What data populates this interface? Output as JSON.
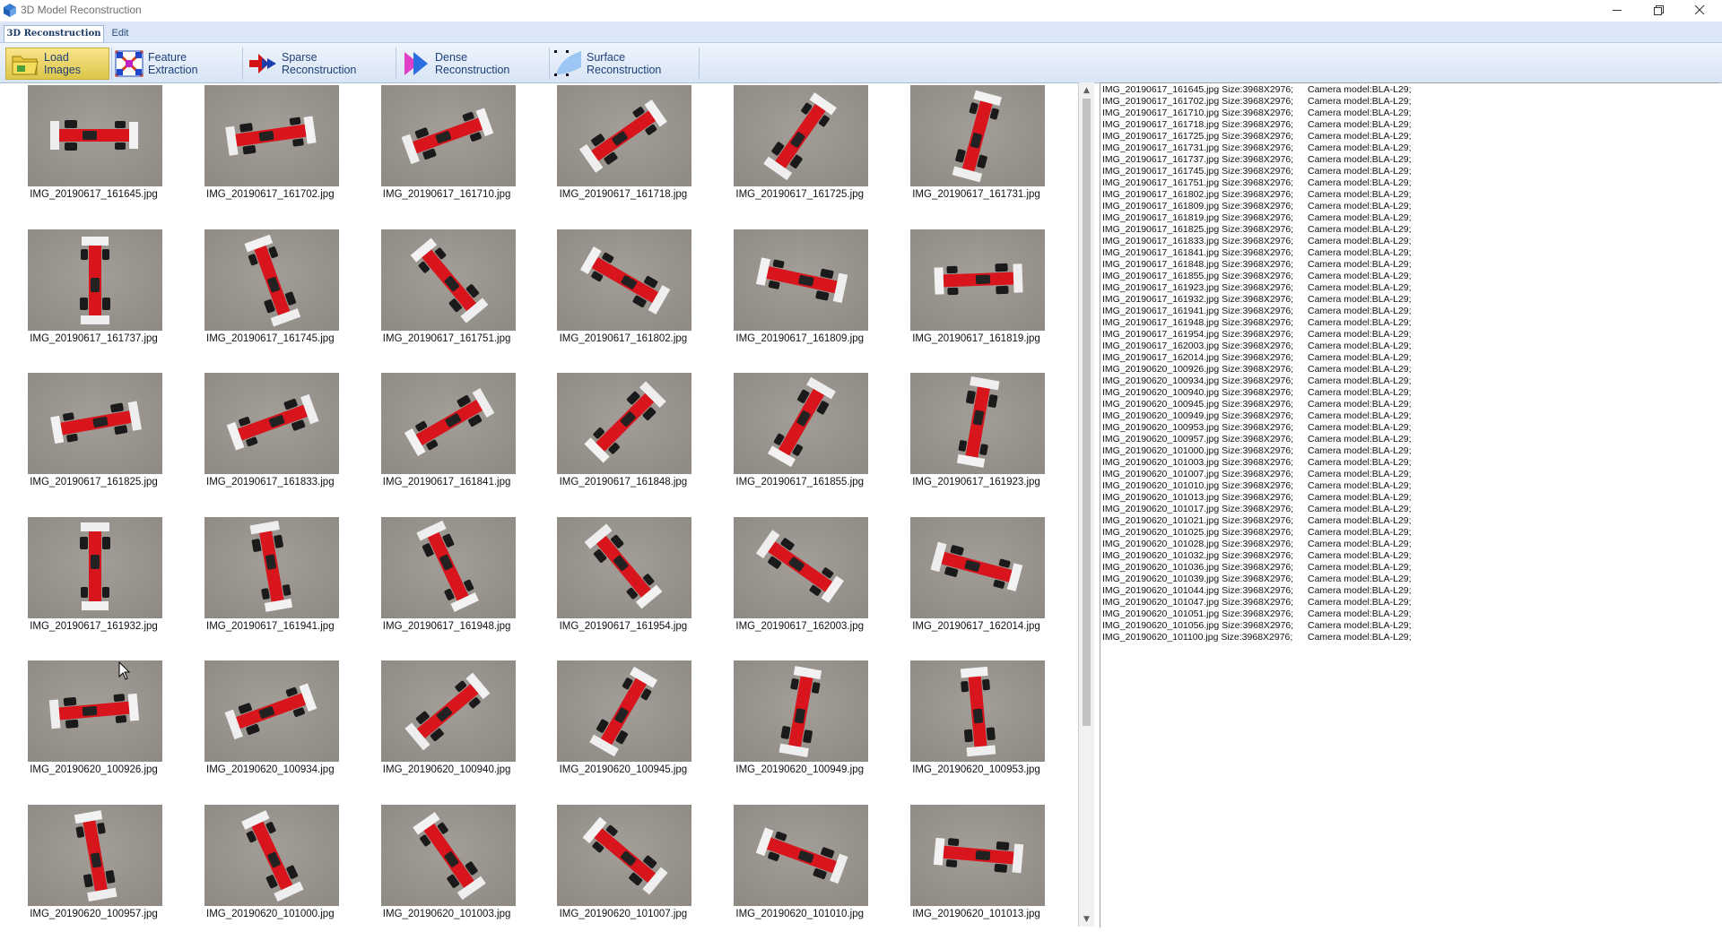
{
  "window": {
    "title": "3D Model Reconstruction",
    "controls": [
      "minimize-icon",
      "restore-icon",
      "close-icon"
    ]
  },
  "menu": {
    "tabs": [
      {
        "label": "3D Reconstruction",
        "active": true
      },
      {
        "label": "Edit",
        "active": false
      }
    ]
  },
  "toolbar": {
    "steps": [
      {
        "label": "Load Images",
        "icon": "folder-icon",
        "active": true
      },
      {
        "label": "Feature Extraction",
        "icon": "feature-grid-icon",
        "active": false
      },
      {
        "label": "Sparse Reconstruction",
        "icon": "sparse-arrows-icon",
        "active": false
      },
      {
        "label": "Dense Reconstruction",
        "icon": "dense-arrows-icon",
        "active": false
      },
      {
        "label": "Surface Reconstruction",
        "icon": "surface-icon",
        "active": false
      }
    ]
  },
  "gallery": {
    "images": [
      "IMG_20190617_161645.jpg",
      "IMG_20190617_161702.jpg",
      "IMG_20190617_161710.jpg",
      "IMG_20190617_161718.jpg",
      "IMG_20190617_161725.jpg",
      "IMG_20190617_161731.jpg",
      "IMG_20190617_161737.jpg",
      "IMG_20190617_161745.jpg",
      "IMG_20190617_161751.jpg",
      "IMG_20190617_161802.jpg",
      "IMG_20190617_161809.jpg",
      "IMG_20190617_161819.jpg",
      "IMG_20190617_161825.jpg",
      "IMG_20190617_161833.jpg",
      "IMG_20190617_161841.jpg",
      "IMG_20190617_161848.jpg",
      "IMG_20190617_161855.jpg",
      "IMG_20190617_161923.jpg",
      "IMG_20190617_161932.jpg",
      "IMG_20190617_161941.jpg",
      "IMG_20190617_161948.jpg",
      "IMG_20190617_161954.jpg",
      "IMG_20190617_162003.jpg",
      "IMG_20190617_162014.jpg",
      "IMG_20190620_100926.jpg",
      "IMG_20190620_100934.jpg",
      "IMG_20190620_100940.jpg",
      "IMG_20190620_100945.jpg",
      "IMG_20190620_100949.jpg",
      "IMG_20190620_100953.jpg",
      "IMG_20190620_100957.jpg",
      "IMG_20190620_101000.jpg",
      "IMG_20190620_101003.jpg",
      "IMG_20190620_101007.jpg",
      "IMG_20190620_101010.jpg",
      "IMG_20190620_101013.jpg"
    ],
    "thumbnail_subject": "red formula race car model on grey carpet"
  },
  "log": {
    "lines": [
      {
        "file": "IMG_20190617_161645.jpg Size:3968X2976;",
        "camera": "Camera model:BLA-L29;"
      },
      {
        "file": "IMG_20190617_161702.jpg Size:3968X2976;",
        "camera": "Camera model:BLA-L29;"
      },
      {
        "file": "IMG_20190617_161710.jpg Size:3968X2976;",
        "camera": "Camera model:BLA-L29;"
      },
      {
        "file": "IMG_20190617_161718.jpg Size:3968X2976;",
        "camera": "Camera model:BLA-L29;"
      },
      {
        "file": "IMG_20190617_161725.jpg Size:3968X2976;",
        "camera": "Camera model:BLA-L29;"
      },
      {
        "file": "IMG_20190617_161731.jpg Size:3968X2976;",
        "camera": "Camera model:BLA-L29;"
      },
      {
        "file": "IMG_20190617_161737.jpg Size:3968X2976;",
        "camera": "Camera model:BLA-L29;"
      },
      {
        "file": "IMG_20190617_161745.jpg Size:3968X2976;",
        "camera": "Camera model:BLA-L29;"
      },
      {
        "file": "IMG_20190617_161751.jpg Size:3968X2976;",
        "camera": "Camera model:BLA-L29;"
      },
      {
        "file": "IMG_20190617_161802.jpg Size:3968X2976;",
        "camera": "Camera model:BLA-L29;"
      },
      {
        "file": "IMG_20190617_161809.jpg Size:3968X2976;",
        "camera": "Camera model:BLA-L29;"
      },
      {
        "file": "IMG_20190617_161819.jpg Size:3968X2976;",
        "camera": "Camera model:BLA-L29;"
      },
      {
        "file": "IMG_20190617_161825.jpg Size:3968X2976;",
        "camera": "Camera model:BLA-L29;"
      },
      {
        "file": "IMG_20190617_161833.jpg Size:3968X2976;",
        "camera": "Camera model:BLA-L29;"
      },
      {
        "file": "IMG_20190617_161841.jpg Size:3968X2976;",
        "camera": "Camera model:BLA-L29;"
      },
      {
        "file": "IMG_20190617_161848.jpg Size:3968X2976;",
        "camera": "Camera model:BLA-L29;"
      },
      {
        "file": "IMG_20190617_161855.jpg Size:3968X2976;",
        "camera": "Camera model:BLA-L29;"
      },
      {
        "file": "IMG_20190617_161923.jpg Size:3968X2976;",
        "camera": "Camera model:BLA-L29;"
      },
      {
        "file": "IMG_20190617_161932.jpg Size:3968X2976;",
        "camera": "Camera model:BLA-L29;"
      },
      {
        "file": "IMG_20190617_161941.jpg Size:3968X2976;",
        "camera": "Camera model:BLA-L29;"
      },
      {
        "file": "IMG_20190617_161948.jpg Size:3968X2976;",
        "camera": "Camera model:BLA-L29;"
      },
      {
        "file": "IMG_20190617_161954.jpg Size:3968X2976;",
        "camera": "Camera model:BLA-L29;"
      },
      {
        "file": "IMG_20190617_162003.jpg Size:3968X2976;",
        "camera": "Camera model:BLA-L29;"
      },
      {
        "file": "IMG_20190617_162014.jpg Size:3968X2976;",
        "camera": "Camera model:BLA-L29;"
      },
      {
        "file": "IMG_20190620_100926.jpg Size:3968X2976;",
        "camera": "Camera model:BLA-L29;"
      },
      {
        "file": "IMG_20190620_100934.jpg Size:3968X2976;",
        "camera": "Camera model:BLA-L29;"
      },
      {
        "file": "IMG_20190620_100940.jpg Size:3968X2976;",
        "camera": "Camera model:BLA-L29;"
      },
      {
        "file": "IMG_20190620_100945.jpg Size:3968X2976;",
        "camera": "Camera model:BLA-L29;"
      },
      {
        "file": "IMG_20190620_100949.jpg Size:3968X2976;",
        "camera": "Camera model:BLA-L29;"
      },
      {
        "file": "IMG_20190620_100953.jpg Size:3968X2976;",
        "camera": "Camera model:BLA-L29;"
      },
      {
        "file": "IMG_20190620_100957.jpg Size:3968X2976;",
        "camera": "Camera model:BLA-L29;"
      },
      {
        "file": "IMG_20190620_101000.jpg Size:3968X2976;",
        "camera": "Camera model:BLA-L29;"
      },
      {
        "file": "IMG_20190620_101003.jpg Size:3968X2976;",
        "camera": "Camera model:BLA-L29;"
      },
      {
        "file": "IMG_20190620_101007.jpg Size:3968X2976;",
        "camera": "Camera model:BLA-L29;"
      },
      {
        "file": "IMG_20190620_101010.jpg Size:3968X2976;",
        "camera": "Camera model:BLA-L29;"
      },
      {
        "file": "IMG_20190620_101013.jpg Size:3968X2976;",
        "camera": "Camera model:BLA-L29;"
      },
      {
        "file": "IMG_20190620_101017.jpg Size:3968X2976;",
        "camera": "Camera model:BLA-L29;"
      },
      {
        "file": "IMG_20190620_101021.jpg Size:3968X2976;",
        "camera": "Camera model:BLA-L29;"
      },
      {
        "file": "IMG_20190620_101025.jpg Size:3968X2976;",
        "camera": "Camera model:BLA-L29;"
      },
      {
        "file": "IMG_20190620_101028.jpg Size:3968X2976;",
        "camera": "Camera model:BLA-L29;"
      },
      {
        "file": "IMG_20190620_101032.jpg Size:3968X2976;",
        "camera": "Camera model:BLA-L29;"
      },
      {
        "file": "IMG_20190620_101036.jpg Size:3968X2976;",
        "camera": "Camera model:BLA-L29;"
      },
      {
        "file": "IMG_20190620_101039.jpg Size:3968X2976;",
        "camera": "Camera model:BLA-L29;"
      },
      {
        "file": "IMG_20190620_101044.jpg Size:3968X2976;",
        "camera": "Camera model:BLA-L29;"
      },
      {
        "file": "IMG_20190620_101047.jpg Size:3968X2976;",
        "camera": "Camera model:BLA-L29;"
      },
      {
        "file": "IMG_20190620_101051.jpg Size:3968X2976;",
        "camera": "Camera model:BLA-L29;"
      },
      {
        "file": "IMG_20190620_101056.jpg Size:3968X2976;",
        "camera": "Camera model:BLA-L29;"
      },
      {
        "file": "IMG_20190620_101100.jpg Size:3968X2976;",
        "camera": "Camera model:BLA-L29;"
      }
    ]
  },
  "colors": {
    "ribbon_active": "#f2d970",
    "menubar": "#dbe7f6",
    "car_red": "#d8141c",
    "carpet": "#8f8a84"
  }
}
